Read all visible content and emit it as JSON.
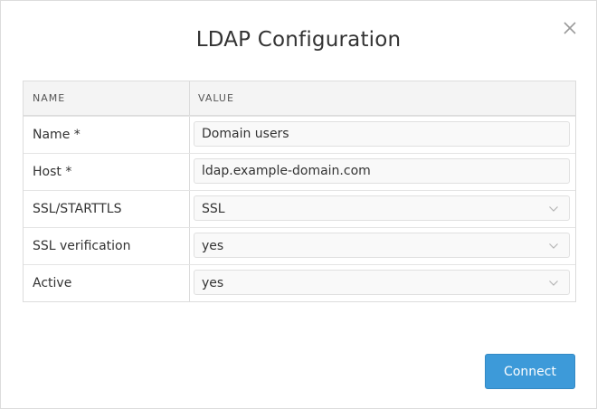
{
  "dialog": {
    "title": "LDAP Configuration",
    "close_icon": "close-icon"
  },
  "table": {
    "columns": [
      "NAME",
      "VALUE"
    ],
    "rows": [
      {
        "label": "Name *",
        "value": "Domain users",
        "type": "text"
      },
      {
        "label": "Host *",
        "value": "ldap.example-domain.com",
        "type": "text"
      },
      {
        "label": "SSL/STARTTLS",
        "value": "SSL",
        "type": "select"
      },
      {
        "label": "SSL verification",
        "value": "yes",
        "type": "select"
      },
      {
        "label": "Active",
        "value": "yes",
        "type": "select"
      }
    ]
  },
  "actions": {
    "connect_label": "Connect"
  },
  "colors": {
    "accent": "#3d9ad9",
    "header_bg": "#f4f4f4",
    "border": "#dcdcdc"
  }
}
